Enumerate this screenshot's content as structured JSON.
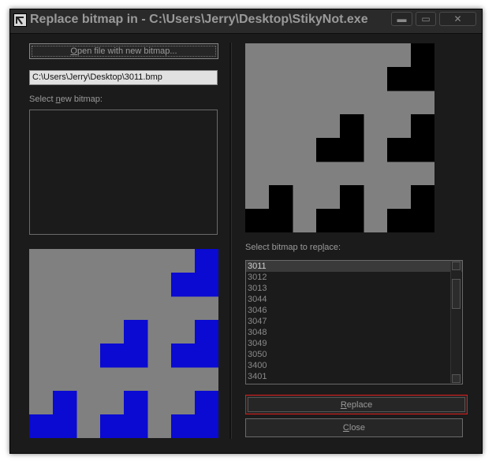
{
  "window": {
    "title": "Replace bitmap in - C:\\Users\\Jerry\\Desktop\\StikyNot.exe",
    "controls": {
      "minimize": "▬",
      "maximize": "▭",
      "close": "✕"
    }
  },
  "left": {
    "open_button": {
      "prefix": "",
      "accel": "O",
      "rest": "pen file with new bitmap..."
    },
    "path_value": "C:\\Users\\Jerry\\Desktop\\3011.bmp",
    "select_new_label": {
      "prefix": "Select ",
      "accel": "n",
      "rest": "ew bitmap:"
    }
  },
  "right": {
    "select_replace_label": {
      "prefix": "Select bitmap to rep",
      "accel": "l",
      "rest": "ace:"
    },
    "bitmaps": [
      "3011",
      "3012",
      "3013",
      "3044",
      "3046",
      "3047",
      "3048",
      "3049",
      "3050",
      "3400",
      "3401"
    ],
    "selected_bitmap": "3011",
    "replace_button": {
      "prefix": "",
      "accel": "R",
      "rest": "eplace"
    },
    "close_button": {
      "prefix": "",
      "accel": "C",
      "rest": "lose"
    }
  },
  "colors": {
    "pattern_bg": "#808080",
    "original_fill": "#000000",
    "new_fill": "#0a0ad2",
    "focus_border": "#e01a1a"
  },
  "pattern_grid": [
    [
      0,
      0,
      0,
      0,
      0,
      0,
      0,
      1
    ],
    [
      0,
      0,
      0,
      0,
      0,
      0,
      1,
      1
    ],
    [
      0,
      0,
      0,
      0,
      0,
      0,
      0,
      0
    ],
    [
      0,
      0,
      0,
      0,
      1,
      0,
      0,
      1
    ],
    [
      0,
      0,
      0,
      1,
      1,
      0,
      1,
      1
    ],
    [
      0,
      0,
      0,
      0,
      0,
      0,
      0,
      0
    ],
    [
      0,
      1,
      0,
      0,
      1,
      0,
      0,
      1
    ],
    [
      1,
      1,
      0,
      1,
      1,
      0,
      1,
      1
    ]
  ],
  "icons": {
    "app": "bitmap-replace-app-icon",
    "scroll_up": "scroll-up-arrow-icon",
    "scroll_down": "scroll-down-arrow-icon"
  }
}
